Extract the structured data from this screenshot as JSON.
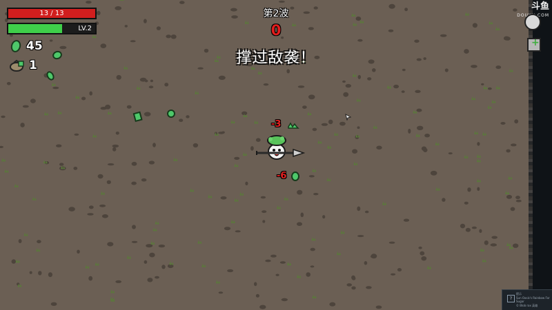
{
  "hud": {
    "hp_text": "13 / 13",
    "hp_fraction": 1.0,
    "level_text": "LV.2",
    "xp_fraction": 0.62,
    "materials_count": "45",
    "bag_count": "1"
  },
  "wave": {
    "title": "第2波",
    "timer": "0",
    "message": "撑过敌袭！"
  },
  "damage_numbers": [
    "-3",
    "-6"
  ],
  "watermark": {
    "brand": "斗鱼",
    "sub": "DOUYU.COM"
  },
  "notification": {
    "icon_glyph": "?",
    "title_text": "提示",
    "body_text": "Sun Oasis's Rainbow For Sugar",
    "footer_text": "© Blob rax 英雄"
  },
  "colors": {
    "ground": "#6b5f54",
    "hp": "#d21e1e",
    "xp": "#3fcf4a",
    "material": "#4ec86a",
    "damage": "#e82020",
    "void": "#0f1317"
  },
  "icons": {
    "material": "green-material-icon",
    "bag": "loot-bag-icon",
    "crate": "health-crate-icon",
    "egg": "egg-icon",
    "cursor": "pointer-cursor-icon"
  }
}
